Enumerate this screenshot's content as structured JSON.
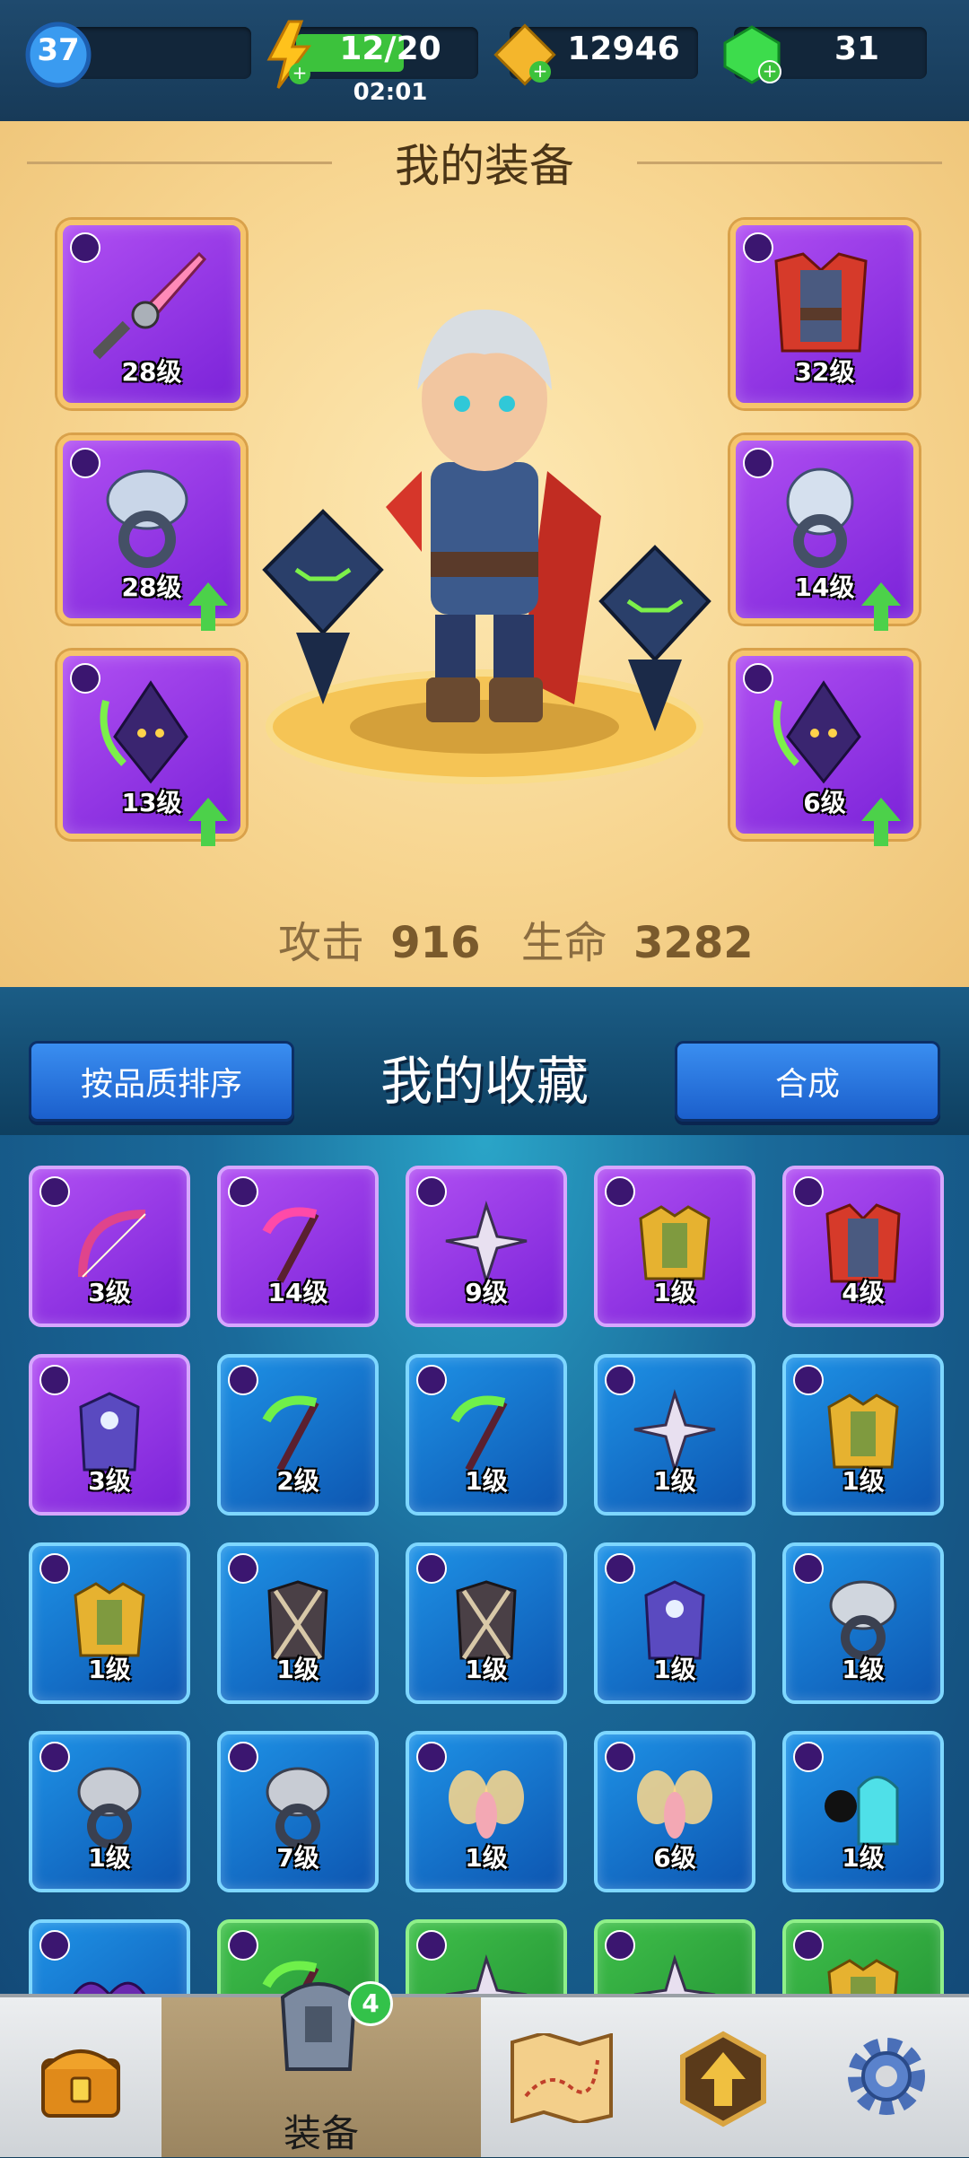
{
  "top_bar": {
    "player_level": "37",
    "energy": "12/20",
    "energy_timer": "02:01",
    "gold": "12946",
    "gems": "31"
  },
  "equipment": {
    "title": "我的装备",
    "slots_left": [
      {
        "item": "sword",
        "level": "28级",
        "upgrade": false
      },
      {
        "item": "dragon-ring",
        "level": "28级",
        "upgrade": true
      },
      {
        "item": "reaper-pet",
        "level": "13级",
        "upgrade": true
      }
    ],
    "slots_right": [
      {
        "item": "red-cape-armor",
        "level": "32级",
        "upgrade": false
      },
      {
        "item": "bear-ring",
        "level": "14级",
        "upgrade": true
      },
      {
        "item": "reaper-pet",
        "level": "6级",
        "upgrade": true
      }
    ],
    "stats": {
      "attack_label": "攻击",
      "attack_value": "916",
      "hp_label": "生命",
      "hp_value": "3282"
    }
  },
  "collection": {
    "title": "我的收藏",
    "sort_button": "按品质排序",
    "merge_button": "合成",
    "rows": [
      [
        {
          "item": "bow",
          "level": "3级",
          "rarity": "epic"
        },
        {
          "item": "scythe",
          "level": "14级",
          "rarity": "epic"
        },
        {
          "item": "shuriken",
          "level": "9级",
          "rarity": "epic"
        },
        {
          "item": "gold-armor",
          "level": "1级",
          "rarity": "epic"
        },
        {
          "item": "red-cape-armor",
          "level": "4级",
          "rarity": "epic"
        }
      ],
      [
        {
          "item": "mage-robe",
          "level": "3级",
          "rarity": "epic"
        },
        {
          "item": "green-scythe",
          "level": "2级",
          "rarity": "rare"
        },
        {
          "item": "green-scythe",
          "level": "1级",
          "rarity": "rare"
        },
        {
          "item": "shuriken",
          "level": "1级",
          "rarity": "rare"
        },
        {
          "item": "gold-armor",
          "level": "1级",
          "rarity": "rare"
        }
      ],
      [
        {
          "item": "gold-armor",
          "level": "1级",
          "rarity": "rare"
        },
        {
          "item": "leather-vest",
          "level": "1级",
          "rarity": "rare"
        },
        {
          "item": "leather-vest",
          "level": "1级",
          "rarity": "rare"
        },
        {
          "item": "mage-robe",
          "level": "1级",
          "rarity": "rare"
        },
        {
          "item": "wolf-ring",
          "level": "1级",
          "rarity": "rare"
        }
      ],
      [
        {
          "item": "eagle-ring",
          "level": "1级",
          "rarity": "rare"
        },
        {
          "item": "eagle-ring",
          "level": "7级",
          "rarity": "rare"
        },
        {
          "item": "fairy-pet",
          "level": "1级",
          "rarity": "rare"
        },
        {
          "item": "fairy-pet",
          "level": "6级",
          "rarity": "rare"
        },
        {
          "item": "ghost-bomb-pet",
          "level": "1级",
          "rarity": "rare"
        }
      ],
      [
        {
          "item": "bat-pet",
          "level": "",
          "rarity": "rare"
        },
        {
          "item": "green-scythe",
          "level": "",
          "rarity": "green"
        },
        {
          "item": "shuriken",
          "level": "",
          "rarity": "green"
        },
        {
          "item": "shuriken",
          "level": "",
          "rarity": "green"
        },
        {
          "item": "gold-armor",
          "level": "",
          "rarity": "green"
        }
      ]
    ]
  },
  "bottom_nav": {
    "items": [
      {
        "icon": "chest-icon",
        "label": ""
      },
      {
        "icon": "armor-icon",
        "label": "装备",
        "badge": "4"
      },
      {
        "icon": "map-icon",
        "label": ""
      },
      {
        "icon": "upgrade-icon",
        "label": ""
      },
      {
        "icon": "gear-icon",
        "label": ""
      }
    ]
  }
}
